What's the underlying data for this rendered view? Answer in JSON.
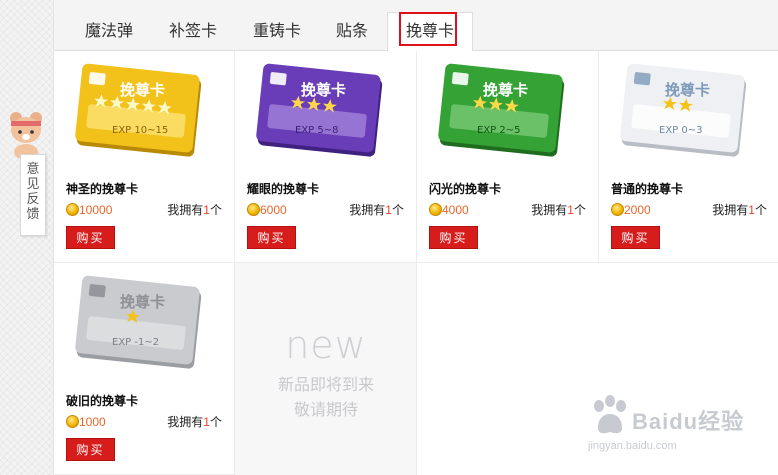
{
  "feedback": {
    "label": "意见反馈"
  },
  "tabs": [
    {
      "label": "魔法弹"
    },
    {
      "label": "补签卡"
    },
    {
      "label": "重铸卡"
    },
    {
      "label": "贴条"
    },
    {
      "label": "挽尊卡",
      "active": true
    }
  ],
  "products": [
    {
      "name": "神圣的挽尊卡",
      "price": "10000",
      "owned_prefix": "我拥有",
      "owned_count": "1",
      "owned_suffix": "个",
      "buy_label": "购买",
      "card_title": "挽尊卡",
      "card_exp": "EXP 10~15",
      "stars": 5,
      "color": "#f3c21a"
    },
    {
      "name": "耀眼的挽尊卡",
      "price": "6000",
      "owned_prefix": "我拥有",
      "owned_count": "1",
      "owned_suffix": "个",
      "buy_label": "购买",
      "card_title": "挽尊卡",
      "card_exp": "EXP 5~8",
      "stars": 3,
      "color": "#6a3db8"
    },
    {
      "name": "闪光的挽尊卡",
      "price": "4000",
      "owned_prefix": "我拥有",
      "owned_count": "1",
      "owned_suffix": "个",
      "buy_label": "购买",
      "card_title": "挽尊卡",
      "card_exp": "EXP 2~5",
      "stars": 3,
      "color": "#35a236"
    },
    {
      "name": "普通的挽尊卡",
      "price": "2000",
      "owned_prefix": "我拥有",
      "owned_count": "1",
      "owned_suffix": "个",
      "buy_label": "购买",
      "card_title": "挽尊卡",
      "card_exp": "EXP 0~3",
      "stars": 2,
      "color": "#e8eaee"
    },
    {
      "name": "破旧的挽尊卡",
      "price": "1000",
      "owned_prefix": "我拥有",
      "owned_count": "1",
      "owned_suffix": "个",
      "buy_label": "购买",
      "card_title": "挽尊卡",
      "card_exp": "EXP -1~2",
      "stars": 1,
      "color": "#c9cbce"
    }
  ],
  "coming_soon": {
    "word": "new",
    "line1": "新品即将到来",
    "line2": "敬请期待"
  },
  "watermark": {
    "brand": "Baidu经验",
    "url": "jingyan.baidu.com"
  }
}
